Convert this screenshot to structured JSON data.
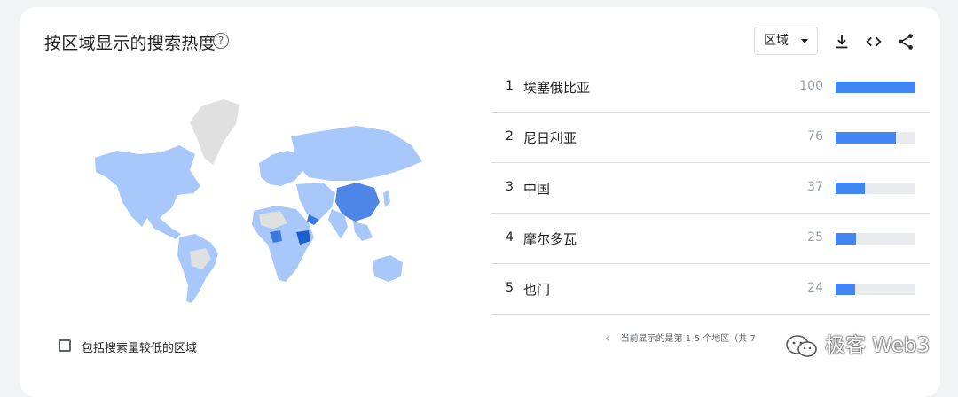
{
  "header": {
    "title": "按区域显示的搜索热度",
    "help_icon": "help-circle-icon",
    "region_select": {
      "selected": "区域"
    },
    "tools": [
      "download-icon",
      "embed-code-icon",
      "share-icon"
    ]
  },
  "checkbox": {
    "label": "包括搜索量较低的区域",
    "checked": false
  },
  "ranking": [
    {
      "rank": "1",
      "name": "埃塞俄比亚",
      "value": "100",
      "fraction": 1.0
    },
    {
      "rank": "2",
      "name": "尼日利亚",
      "value": "76",
      "fraction": 0.76
    },
    {
      "rank": "3",
      "name": "中国",
      "value": "37",
      "fraction": 0.37
    },
    {
      "rank": "4",
      "name": "摩尔多瓦",
      "value": "25",
      "fraction": 0.25
    },
    {
      "rank": "5",
      "name": "也门",
      "value": "24",
      "fraction": 0.24
    }
  ],
  "pager": {
    "text": "当前显示的是第 1-5 个地区（共 7"
  },
  "watermark": {
    "text": "极客 Web3"
  },
  "colors": {
    "bar": "#4285f4",
    "track": "#e8eaed",
    "map_low": "#a8c7fa",
    "map_high": "#3a78e0",
    "map_none": "#e0e0e0"
  }
}
